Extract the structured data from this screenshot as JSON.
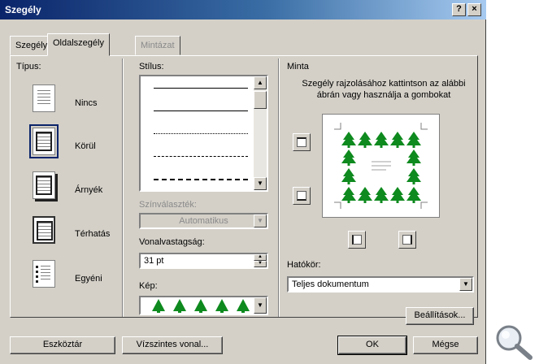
{
  "window": {
    "title": "Szegély",
    "help_button": "?",
    "close_button": "×"
  },
  "tabs": [
    {
      "label": "Szegély"
    },
    {
      "label": "Oldalszegély"
    },
    {
      "label": "Mintázat"
    }
  ],
  "type_section": {
    "label": "Típus:",
    "options": [
      {
        "label": "Nincs"
      },
      {
        "label": "Körül"
      },
      {
        "label": "Árnyék"
      },
      {
        "label": "Térhatás"
      },
      {
        "label": "Egyéni"
      }
    ],
    "selected": "Körül"
  },
  "style_section": {
    "label": "Stílus:",
    "color_label": "Színválaszték:",
    "color_value": "Automatikus",
    "width_label": "Vonalvastagság:",
    "width_value": "31 pt",
    "art_label": "Kép:"
  },
  "preview_section": {
    "label": "Minta",
    "instruction": "Szegély rajzolásához kattintson az alábbi ábrán vagy használja a gombokat",
    "apply_label": "Hatókör:",
    "apply_value": "Teljes dokumentum",
    "options_button": "Beállítások..."
  },
  "footer": {
    "toolbar_button": "Eszköztár",
    "horizontal_line_button": "Vízszintes vonal...",
    "ok_button": "OK",
    "cancel_button": "Mégse"
  },
  "colors": {
    "title_gradient_start": "#0a246a",
    "title_gradient_end": "#a6caf0",
    "dialog_face": "#d4d0c8",
    "tree_green": "#0e8a1e"
  }
}
